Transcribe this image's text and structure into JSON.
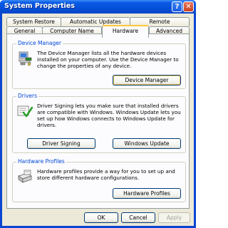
{
  "window": {
    "title": "System Properties",
    "help_glyph": "?",
    "close_glyph": "✕"
  },
  "tabs": {
    "row1": [
      "System Restore",
      "Automatic Updates",
      "Remote"
    ],
    "row2": [
      "General",
      "Computer Name",
      "Hardware",
      "Advanced"
    ],
    "active": "Hardware"
  },
  "device_manager": {
    "title": "Device Manager",
    "text": "The Device Manager lists all the hardware devices installed on your computer. Use the Device Manager to change the properties of any device.",
    "button": "Device Manager",
    "icon": "computer-devices-icon"
  },
  "drivers": {
    "title": "Drivers",
    "text": "Driver Signing lets you make sure that installed drivers are compatible with Windows. Windows Update lets you set up how Windows connects to Windows Update for drivers.",
    "buttons": {
      "signing": "Driver Signing",
      "update": "Windows Update"
    },
    "icon": "driver-signing-icon"
  },
  "hardware_profiles": {
    "title": "Hardware Profiles",
    "text": "Hardware profiles provide a way for you to set up and store different hardware configurations.",
    "button": "Hardware Profiles",
    "icon": "hardware-profiles-icon"
  },
  "footer": {
    "ok": "OK",
    "cancel": "Cancel",
    "apply": "Apply"
  },
  "colors": {
    "title_bar": "#0a5ae6",
    "group_title": "#0046d5",
    "face": "#ece9d8",
    "active_tab_accent": "#ffc83c"
  }
}
